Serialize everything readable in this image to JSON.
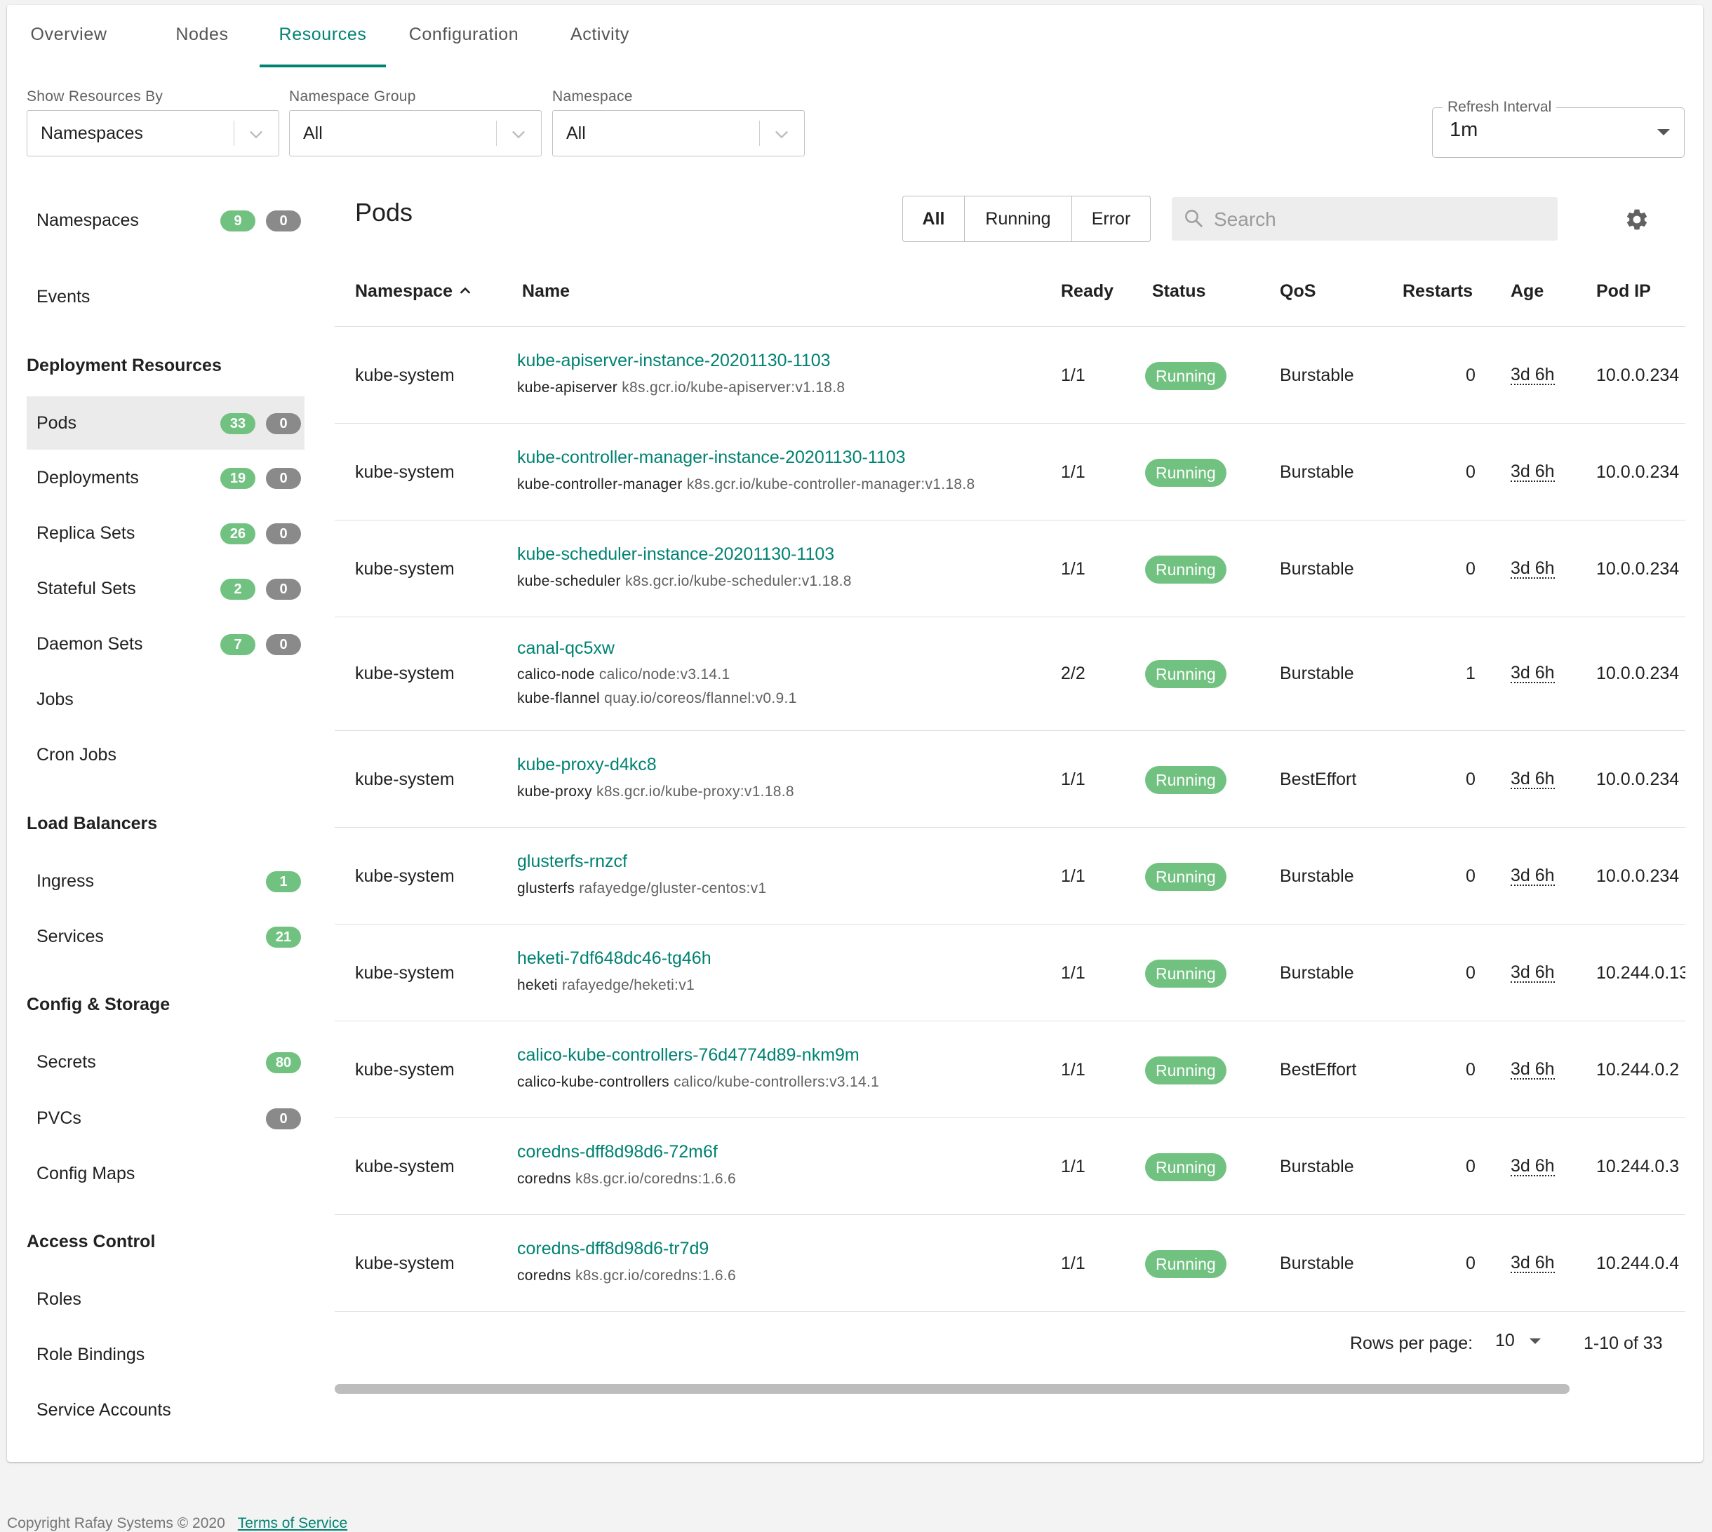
{
  "tabs": [
    "Overview",
    "Nodes",
    "Resources",
    "Configuration",
    "Activity"
  ],
  "active_tab": "Resources",
  "filters": {
    "show_by": {
      "label": "Show Resources By",
      "value": "Namespaces"
    },
    "namespace_group": {
      "label": "Namespace Group",
      "value": "All"
    },
    "namespace": {
      "label": "Namespace",
      "value": "All"
    },
    "refresh": {
      "label": "Refresh Interval",
      "value": "1m"
    }
  },
  "sidebar": {
    "namespaces": {
      "label": "Namespaces",
      "ok": "9",
      "err": "0"
    },
    "events": {
      "label": "Events"
    },
    "deployment_resources": {
      "heading": "Deployment Resources",
      "items": [
        {
          "label": "Pods",
          "ok": "33",
          "err": "0"
        },
        {
          "label": "Deployments",
          "ok": "19",
          "err": "0"
        },
        {
          "label": "Replica Sets",
          "ok": "26",
          "err": "0"
        },
        {
          "label": "Stateful Sets",
          "ok": "2",
          "err": "0"
        },
        {
          "label": "Daemon Sets",
          "ok": "7",
          "err": "0"
        },
        {
          "label": "Jobs"
        },
        {
          "label": "Cron Jobs"
        }
      ]
    },
    "load_balancers": {
      "heading": "Load Balancers",
      "items": [
        {
          "label": "Ingress",
          "ok": "1"
        },
        {
          "label": "Services",
          "ok": "21"
        }
      ]
    },
    "config_storage": {
      "heading": "Config & Storage",
      "items": [
        {
          "label": "Secrets",
          "ok": "80"
        },
        {
          "label": "PVCs",
          "err": "0"
        },
        {
          "label": "Config Maps"
        }
      ]
    },
    "access_control": {
      "heading": "Access Control",
      "items": [
        {
          "label": "Roles"
        },
        {
          "label": "Role Bindings"
        },
        {
          "label": "Service Accounts"
        }
      ]
    }
  },
  "main": {
    "title": "Pods",
    "filter_buttons": [
      "All",
      "Running",
      "Error"
    ],
    "search_placeholder": "Search",
    "columns": [
      "Namespace",
      "Name",
      "Ready",
      "Status",
      "QoS",
      "Restarts",
      "Age",
      "Pod IP"
    ],
    "rows": [
      {
        "namespace": "kube-system",
        "name": "kube-apiserver-instance-20201130-1103",
        "containers": [
          {
            "name": "kube-apiserver",
            "image": "k8s.gcr.io/kube-apiserver:v1.18.8"
          }
        ],
        "ready": "1/1",
        "status": "Running",
        "qos": "Burstable",
        "restarts": "0",
        "age": "3d 6h",
        "ip": "10.0.0.234"
      },
      {
        "namespace": "kube-system",
        "name": "kube-controller-manager-instance-20201130-1103",
        "containers": [
          {
            "name": "kube-controller-manager",
            "image": "k8s.gcr.io/kube-controller-manager:v1.18.8"
          }
        ],
        "ready": "1/1",
        "status": "Running",
        "qos": "Burstable",
        "restarts": "0",
        "age": "3d 6h",
        "ip": "10.0.0.234"
      },
      {
        "namespace": "kube-system",
        "name": "kube-scheduler-instance-20201130-1103",
        "containers": [
          {
            "name": "kube-scheduler",
            "image": "k8s.gcr.io/kube-scheduler:v1.18.8"
          }
        ],
        "ready": "1/1",
        "status": "Running",
        "qos": "Burstable",
        "restarts": "0",
        "age": "3d 6h",
        "ip": "10.0.0.234"
      },
      {
        "namespace": "kube-system",
        "name": "canal-qc5xw",
        "containers": [
          {
            "name": "calico-node",
            "image": "calico/node:v3.14.1"
          },
          {
            "name": "kube-flannel",
            "image": "quay.io/coreos/flannel:v0.9.1"
          }
        ],
        "ready": "2/2",
        "status": "Running",
        "qos": "Burstable",
        "restarts": "1",
        "age": "3d 6h",
        "ip": "10.0.0.234"
      },
      {
        "namespace": "kube-system",
        "name": "kube-proxy-d4kc8",
        "containers": [
          {
            "name": "kube-proxy",
            "image": "k8s.gcr.io/kube-proxy:v1.18.8"
          }
        ],
        "ready": "1/1",
        "status": "Running",
        "qos": "BestEffort",
        "restarts": "0",
        "age": "3d 6h",
        "ip": "10.0.0.234"
      },
      {
        "namespace": "kube-system",
        "name": "glusterfs-rnzcf",
        "containers": [
          {
            "name": "glusterfs",
            "image": "rafayedge/gluster-centos:v1"
          }
        ],
        "ready": "1/1",
        "status": "Running",
        "qos": "Burstable",
        "restarts": "0",
        "age": "3d 6h",
        "ip": "10.0.0.234"
      },
      {
        "namespace": "kube-system",
        "name": "heketi-7df648dc46-tg46h",
        "containers": [
          {
            "name": "heketi",
            "image": "rafayedge/heketi:v1"
          }
        ],
        "ready": "1/1",
        "status": "Running",
        "qos": "Burstable",
        "restarts": "0",
        "age": "3d 6h",
        "ip": "10.244.0.13"
      },
      {
        "namespace": "kube-system",
        "name": "calico-kube-controllers-76d4774d89-nkm9m",
        "containers": [
          {
            "name": "calico-kube-controllers",
            "image": "calico/kube-controllers:v3.14.1"
          }
        ],
        "ready": "1/1",
        "status": "Running",
        "qos": "BestEffort",
        "restarts": "0",
        "age": "3d 6h",
        "ip": "10.244.0.2"
      },
      {
        "namespace": "kube-system",
        "name": "coredns-dff8d98d6-72m6f",
        "containers": [
          {
            "name": "coredns",
            "image": "k8s.gcr.io/coredns:1.6.6"
          }
        ],
        "ready": "1/1",
        "status": "Running",
        "qos": "Burstable",
        "restarts": "0",
        "age": "3d 6h",
        "ip": "10.244.0.3"
      },
      {
        "namespace": "kube-system",
        "name": "coredns-dff8d98d6-tr7d9",
        "containers": [
          {
            "name": "coredns",
            "image": "k8s.gcr.io/coredns:1.6.6"
          }
        ],
        "ready": "1/1",
        "status": "Running",
        "qos": "Burstable",
        "restarts": "0",
        "age": "3d 6h",
        "ip": "10.244.0.4"
      }
    ],
    "pagination": {
      "rows_per_page_label": "Rows per page:",
      "rows_per_page": "10",
      "range": "1-10 of 33"
    }
  },
  "footer": {
    "copyright": "Copyright Rafay Systems © 2020",
    "terms": "Terms of Service"
  },
  "colors": {
    "accent": "#008272",
    "ok_badge": "#71c281",
    "zero_badge": "#8a8a8a",
    "status_running": "#71c281"
  }
}
